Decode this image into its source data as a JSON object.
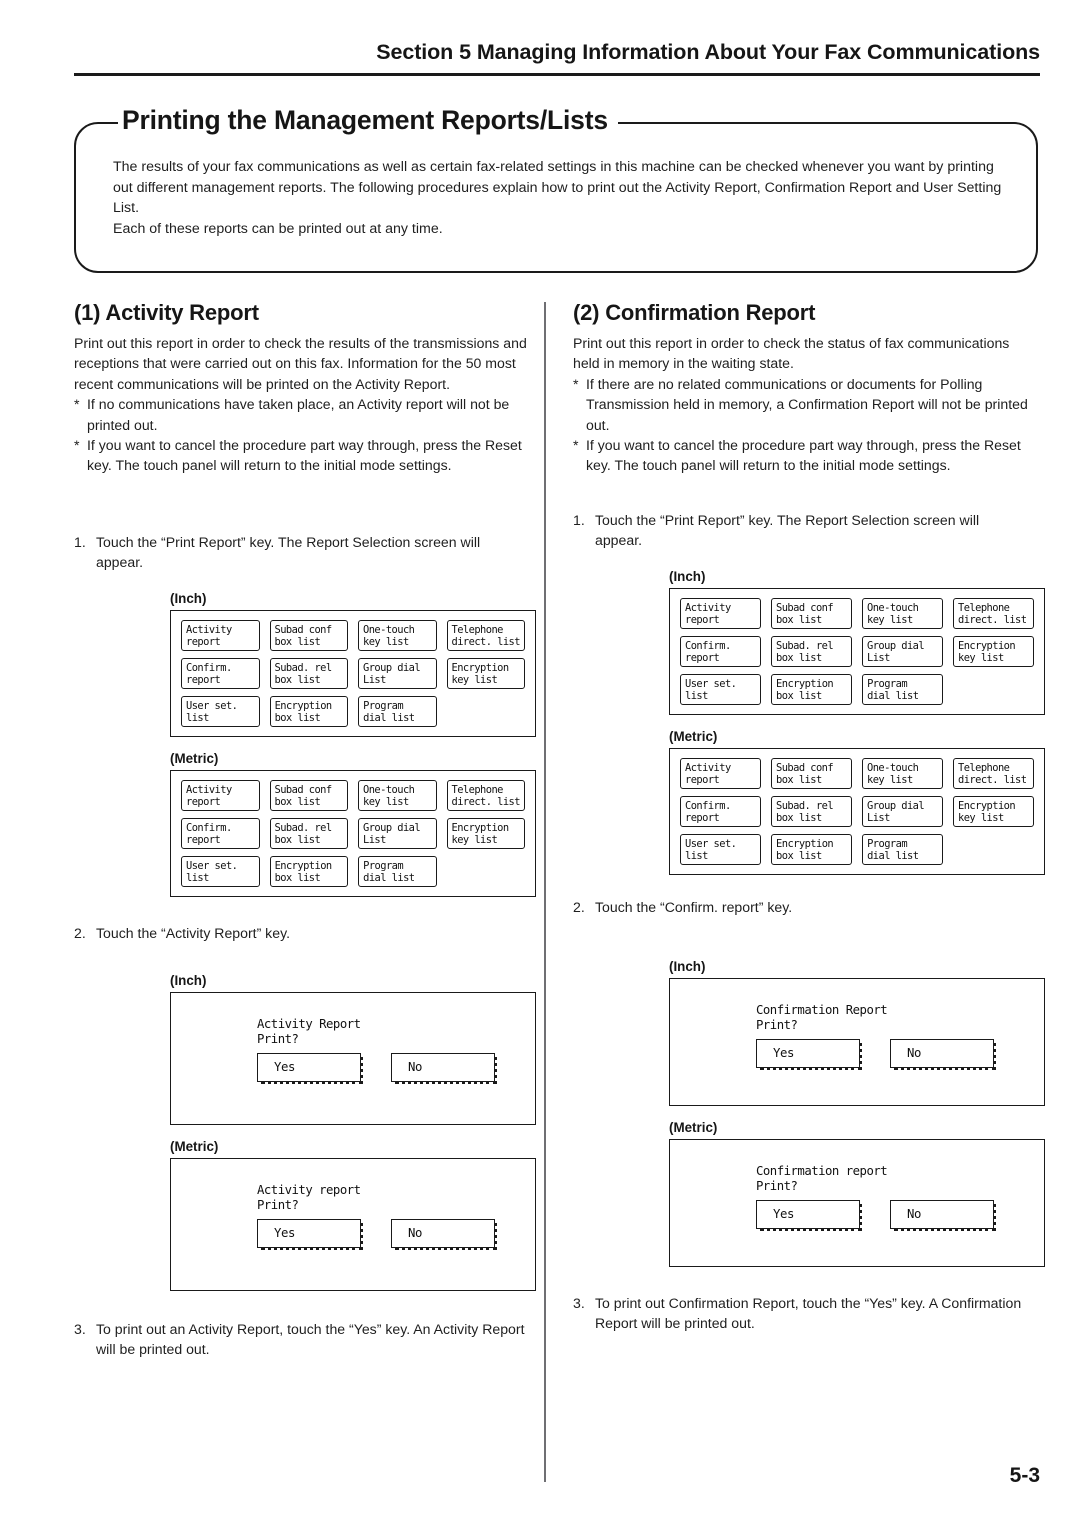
{
  "header": {
    "section_label": "Section 5  Managing Information About Your Fax Communications"
  },
  "title": "Printing the Management Reports/Lists",
  "intro": {
    "paragraph_1": "The results of your fax communications as well as certain fax-related settings in this machine can be checked whenever you want by printing out different management reports. The following procedures explain how to print out the Activity Report, Confirmation Report and User Setting List.",
    "paragraph_2": "Each of these reports can be printed out at any time."
  },
  "left_column": {
    "heading": "(1) Activity Report",
    "intro": "Print out this report in order to check the results of the transmissions and receptions that were carried out on this fax. Information for the 50 most recent communications will be printed on the Activity Report.",
    "note_marker": "*",
    "note_1": "If no communications have taken place, an Activity report will not be printed out.",
    "note_2": "If you want to cancel the procedure part way through, press the Reset key. The touch panel will return to the initial mode settings.",
    "step_1_num": "1.",
    "step_1": "Touch the “Print Report” key. The Report Selection screen will appear.",
    "step_2_num": "2.",
    "step_2": "Touch the “Activity Report” key.",
    "step_3_num": "3.",
    "step_3": "To print out an Activity Report, touch the “Yes” key. An Activity Report will be printed out.",
    "screens": {
      "selection_inch_label": "(Inch)",
      "selection_metric_label": "(Metric)",
      "dialog_inch_label": "(Inch)",
      "dialog_metric_label": "(Metric)"
    },
    "dialog_inch": {
      "line1": "Activity Report",
      "line2": "Print?",
      "yes": "Yes",
      "no": "No"
    },
    "dialog_metric": {
      "line1": "Activity report",
      "line2": "Print?",
      "yes": "Yes",
      "no": "No"
    }
  },
  "right_column": {
    "heading": "(2) Confirmation Report",
    "intro": "Print out this report in order to check the status of fax communications held in memory in the waiting state.",
    "note_marker": "*",
    "note_1": "If there are no related communications or documents for Polling Transmission held in memory, a Confirmation Report will not be printed out.",
    "note_2": "If you want to cancel the procedure part way through, press the Reset key. The touch panel will return to the initial mode settings.",
    "step_1_num": "1.",
    "step_1": "Touch the “Print Report” key. The Report Selection screen will appear.",
    "step_2_num": "2.",
    "step_2": "Touch the “Confirm. report” key.",
    "step_3_num": "3.",
    "step_3": "To print out Confirmation Report, touch the “Yes” key. A Confirmation Report will be printed out.",
    "screens": {
      "selection_inch_label": "(Inch)",
      "selection_metric_label": "(Metric)",
      "dialog_inch_label": "(Inch)",
      "dialog_metric_label": "(Metric)"
    },
    "dialog_inch": {
      "line1": "Confirmation Report",
      "line2": "Print?",
      "yes": "Yes",
      "no": "No"
    },
    "dialog_metric": {
      "line1": "Confirmation report",
      "line2": "Print?",
      "yes": "Yes",
      "no": "No"
    }
  },
  "report_selection_keys": [
    [
      {
        "l1": "Activity",
        "l2": "report"
      },
      {
        "l1": "Subad conf",
        "l2": "box list"
      },
      {
        "l1": "One-touch",
        "l2": "key list"
      },
      {
        "l1": "Telephone",
        "l2": "direct. list"
      }
    ],
    [
      {
        "l1": "Confirm.",
        "l2": "report"
      },
      {
        "l1": "Subad. rel",
        "l2": "box list"
      },
      {
        "l1": "Group dial",
        "l2": "List"
      },
      {
        "l1": "Encryption",
        "l2": "key list"
      }
    ],
    [
      {
        "l1": "User set.",
        "l2": "list"
      },
      {
        "l1": "Encryption",
        "l2": "box list"
      },
      {
        "l1": "Program",
        "l2": "dial list"
      },
      {
        "l1": "",
        "l2": ""
      }
    ]
  ],
  "page_number": "5-3",
  "colors": {
    "ink": "#1a1a1a",
    "divider": "#6f6f73",
    "paper": "#ffffff"
  }
}
